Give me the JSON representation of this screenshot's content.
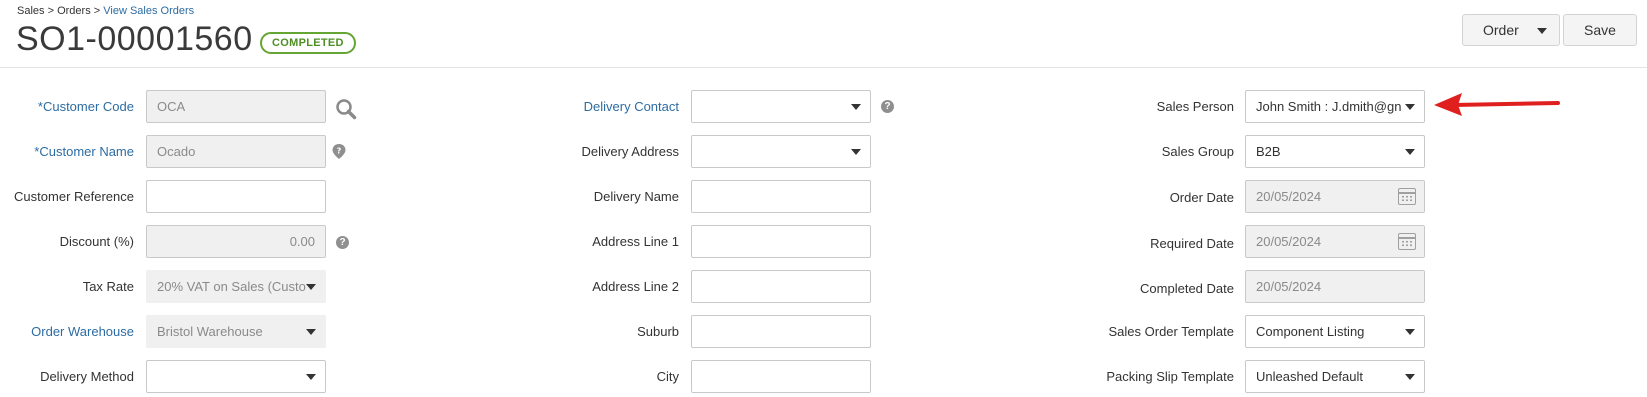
{
  "breadcrumb": {
    "sales": "Sales",
    "sep1": " > ",
    "orders": "Orders",
    "sep2": " > ",
    "current": "View Sales Orders"
  },
  "header": {
    "title": "SO1-00001560",
    "status": "COMPLETED",
    "order_label": "Order",
    "save_label": "Save"
  },
  "left": {
    "customer_code_label": "*Customer Code",
    "customer_code_value": "OCA",
    "customer_name_label": "*Customer Name",
    "customer_name_value": "Ocado",
    "customer_reference_label": "Customer Reference",
    "customer_reference_value": "",
    "discount_label": "Discount (%)",
    "discount_value": "0.00",
    "tax_rate_label": "Tax Rate",
    "tax_rate_value": "20% VAT on Sales (Custo",
    "order_warehouse_label": "Order Warehouse",
    "order_warehouse_value": "Bristol Warehouse",
    "delivery_method_label": "Delivery Method",
    "delivery_method_value": ""
  },
  "middle": {
    "delivery_contact_label": "Delivery Contact",
    "delivery_address_label": "Delivery Address",
    "delivery_name_label": "Delivery Name",
    "address_line1_label": "Address Line 1",
    "address_line2_label": "Address Line 2",
    "suburb_label": "Suburb",
    "city_label": "City"
  },
  "right": {
    "sales_person_label": "Sales Person",
    "sales_person_value": "John Smith : J.dmith@gn",
    "sales_group_label": "Sales Group",
    "sales_group_value": "B2B",
    "order_date_label": "Order Date",
    "order_date_value": "20/05/2024",
    "required_date_label": "Required Date",
    "required_date_value": "20/05/2024",
    "completed_date_label": "Completed Date",
    "completed_date_value": "20/05/2024",
    "sales_order_template_label": "Sales Order Template",
    "sales_order_template_value": "Component Listing",
    "packing_slip_template_label": "Packing Slip Template",
    "packing_slip_template_value": "Unleashed Default"
  },
  "colors": {
    "link": "#2d6ca2",
    "badge": "#64a533",
    "arrow": "#e0201f"
  },
  "icons": {
    "search": "search-icon",
    "help": "help-icon",
    "calendar": "calendar-icon",
    "arrow": "red-arrow-annotation"
  }
}
